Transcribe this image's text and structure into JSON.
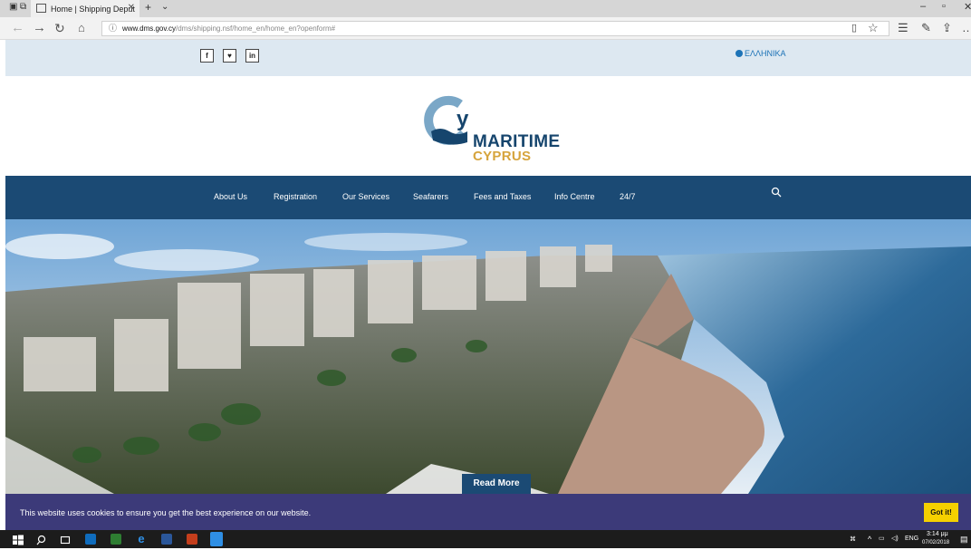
{
  "browser": {
    "tab_title": "Home | Shipping Deput",
    "url_domain": "www.dms.gov.cy",
    "url_path": "/dms/shipping.nsf/home_en/home_en?openform#"
  },
  "top": {
    "social": [
      "f",
      "♥",
      "in"
    ],
    "language": "ΕΛΛΗΝΙΚΑ"
  },
  "logo": {
    "line1": "MARITIME",
    "line2": "CYPRUS"
  },
  "nav": {
    "items": [
      "About Us",
      "Registration",
      "Our Services",
      "Seafarers",
      "Fees and Taxes",
      "Info Centre",
      "24/7"
    ]
  },
  "hero": {
    "read_more": "Read More"
  },
  "cookie": {
    "message": "This website uses cookies to ensure you get the best experience on our website.",
    "button": "Got it!"
  },
  "taskbar": {
    "lang": "ENG",
    "time": "3:14 μμ",
    "date": "07/02/2018"
  },
  "colors": {
    "nav_blue": "#1b4a74",
    "accent_gold": "#d6a43c",
    "cookie_bg": "#3c3a79",
    "cookie_btn": "#f5d000"
  }
}
